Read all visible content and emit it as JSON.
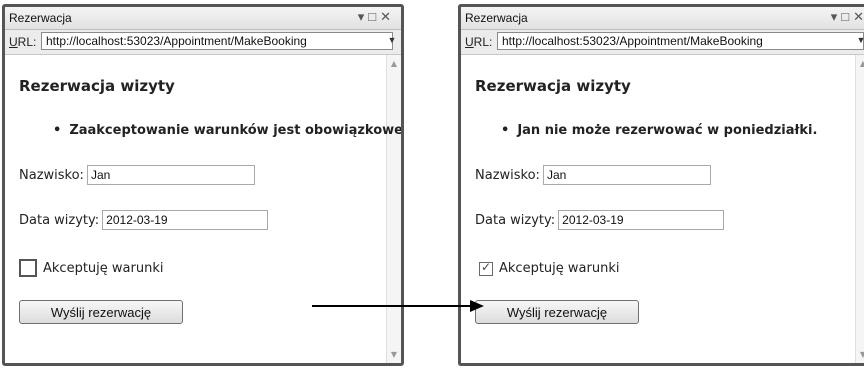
{
  "left": {
    "window_title": "Rezerwacja",
    "url_label_u": "U",
    "url_label_rest": "RL:",
    "url": "http://localhost:53023/Appointment/MakeBooking",
    "heading": "Rezerwacja wizyty",
    "error": "Zaakceptowanie warunków jest obowiązkowe.",
    "name_label": "Nazwisko:",
    "name_value": "Jan",
    "date_label": "Data wizyty:",
    "date_value": "2012-03-19",
    "terms_label": "Akceptuję warunki",
    "terms_checked": false,
    "submit_label": "Wyślij rezerwację"
  },
  "right": {
    "window_title": "Rezerwacja",
    "url_label_u": "U",
    "url_label_rest": "RL:",
    "url": "http://localhost:53023/Appointment/MakeBooking",
    "heading": "Rezerwacja wizyty",
    "error": "Jan nie może rezerwować w poniedziałki.",
    "name_label": "Nazwisko:",
    "name_value": "Jan",
    "date_label": "Data wizyty:",
    "date_value": "2012-03-19",
    "terms_label": "Akceptuję warunki",
    "terms_checked": true,
    "submit_label": "Wyślij rezerwację"
  },
  "icons": {
    "window_controls": "window-controls-icon",
    "url_dropdown": "chevron-down-icon",
    "checkmark": "checkmark-icon",
    "arrow": "arrow-right-icon"
  },
  "colors": {
    "window_border": "#555555",
    "arrow": "#000000"
  }
}
